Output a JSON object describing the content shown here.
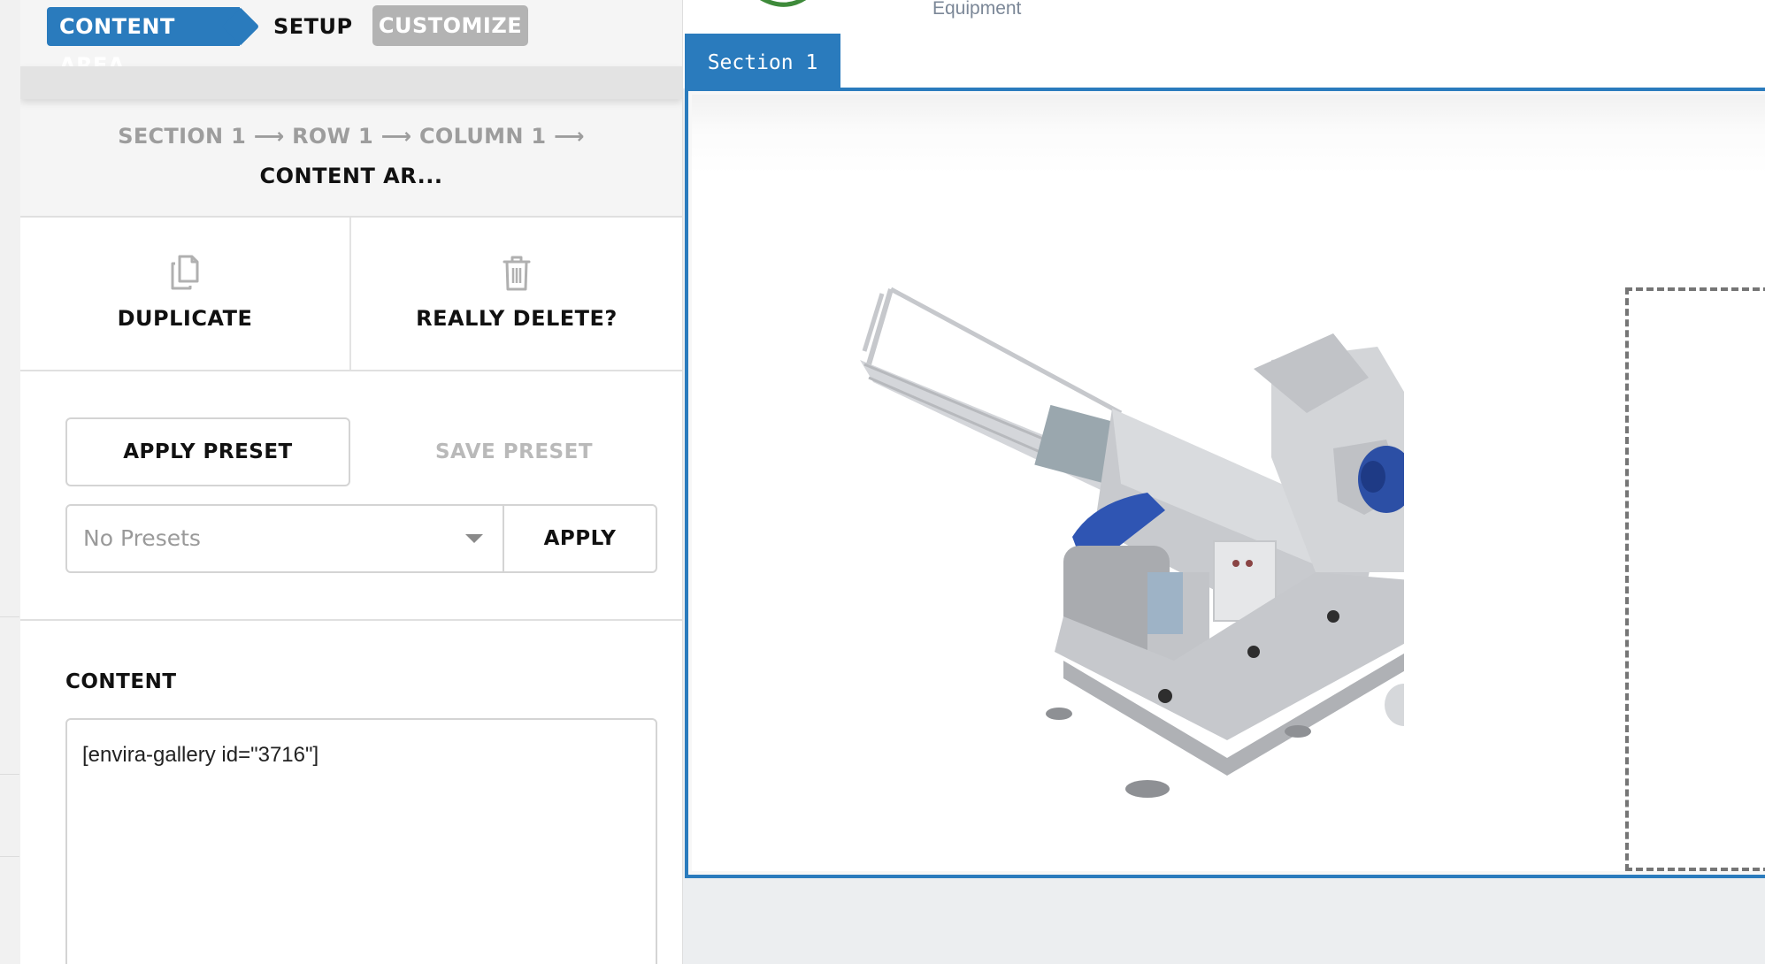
{
  "panel": {
    "tabs": [
      {
        "label": "CONTENT AREA",
        "active": true
      },
      {
        "label": "SETUP",
        "active": false
      },
      {
        "label": "CUSTOMIZE",
        "active": false
      }
    ],
    "breadcrumb": {
      "path": "SECTION 1 ⟶ ROW 1 ⟶ COLUMN 1 ⟶",
      "current": "CONTENT AR..."
    },
    "actions": {
      "duplicate_label": "DUPLICATE",
      "delete_label": "REALLY DELETE?"
    },
    "presets": {
      "apply_preset_label": "APPLY PRESET",
      "save_preset_label": "SAVE PRESET",
      "select_value": "No Presets",
      "apply_label": "APPLY"
    },
    "content": {
      "label": "CONTENT",
      "value": "[envira-gallery id=\"3716\"]"
    }
  },
  "preview": {
    "logo_text": "Equipment",
    "section_tab_label": "Section 1",
    "image_subject": "industrial hammer mill machine"
  },
  "colors": {
    "accent": "#2a7bbd",
    "customize_tab_bg": "#b3b3b3",
    "muted_text": "#9d9d9d"
  },
  "icons": {
    "duplicate": "copy-icon",
    "delete": "trash-icon",
    "select_arrow": "caret-down-icon"
  }
}
